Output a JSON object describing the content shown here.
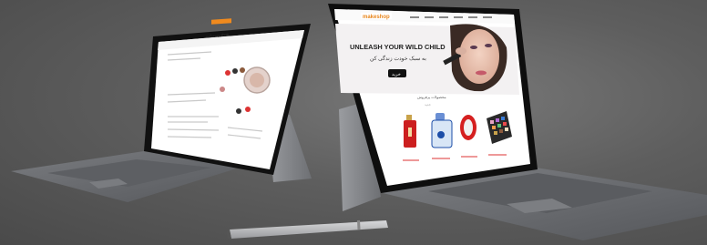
{
  "left_tablet": {
    "logo_text": "وب‌سایت shop",
    "tagline": ""
  },
  "right_tablet": {
    "logo_text": "makeshop",
    "headline": "UNLEASH YOUR WILD CHILD",
    "subheadline": "به سبک خودت زندگی کن",
    "cta_label": "خرید",
    "section_title": "محصولات پرفروش",
    "section_subtitle": "جدید"
  },
  "colors": {
    "background": "#5e5e5e",
    "keyboard": "#6b6d70",
    "screen_bezel": "#111111",
    "screen_bg": "#ffffff",
    "accent_orange": "#f08a1e",
    "accent_red": "#cc1f1f",
    "accent_pink": "#e8a0a8"
  }
}
